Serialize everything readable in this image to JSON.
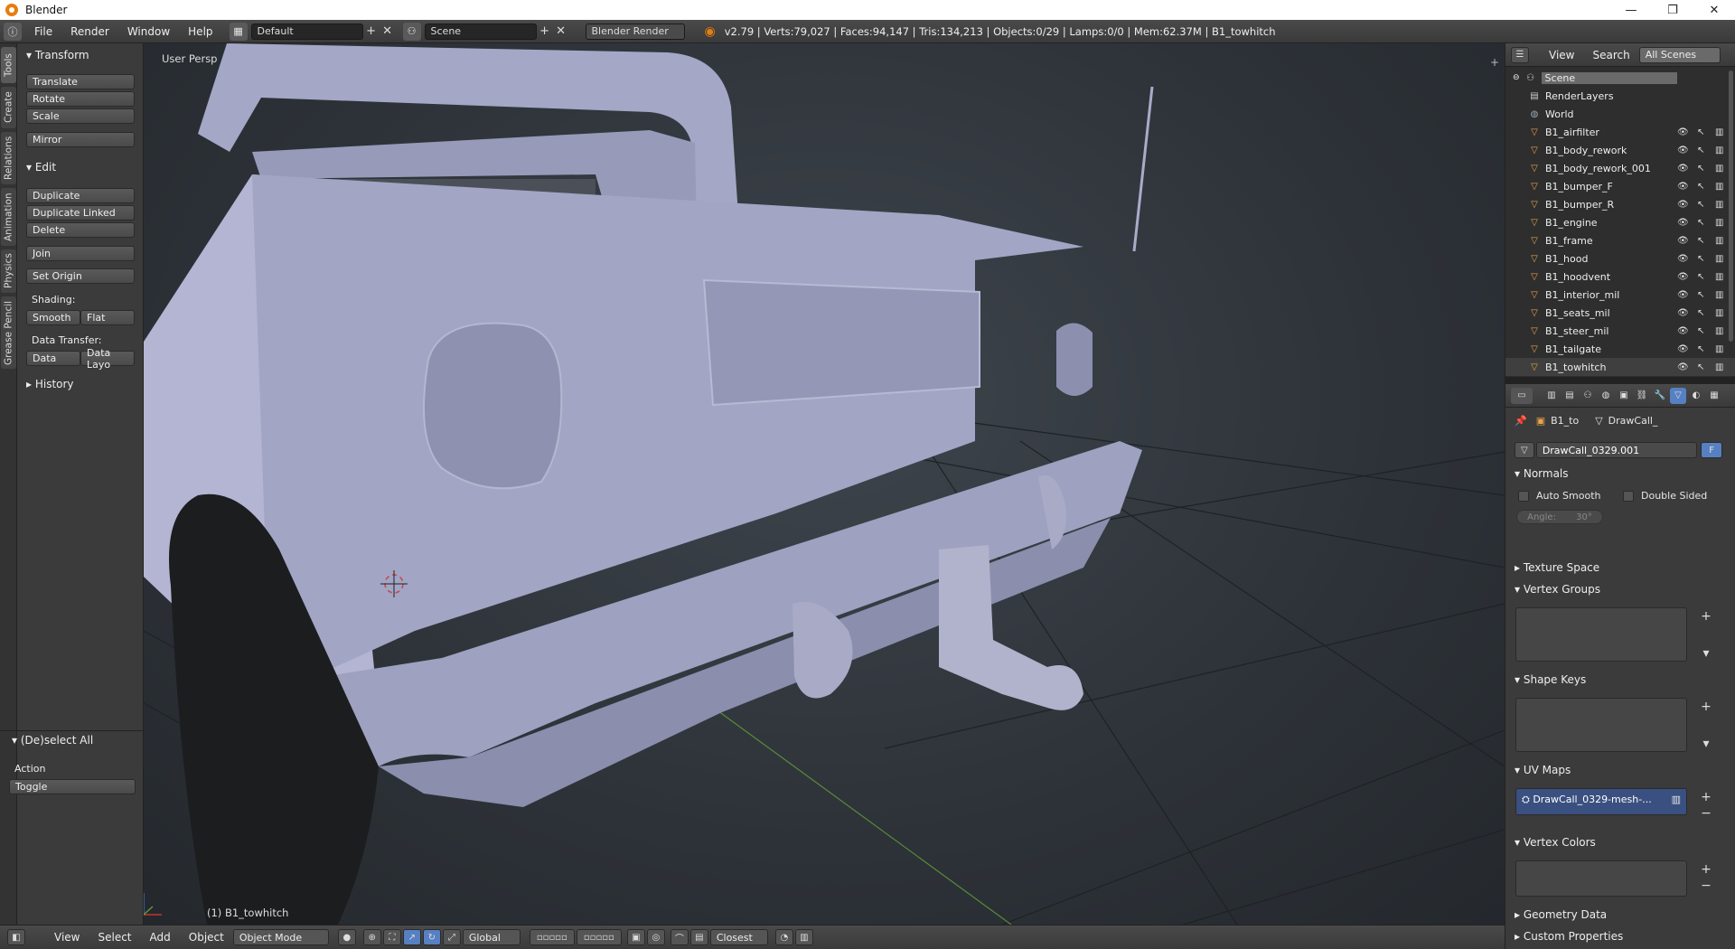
{
  "window": {
    "title": "Blender",
    "minimize": "—",
    "maximize": "❐",
    "close": "✕"
  },
  "infobar": {
    "menus": [
      "File",
      "Render",
      "Window",
      "Help"
    ],
    "layout": "Default",
    "scene": "Scene",
    "engine": "Blender Render",
    "stats": "v2.79 | Verts:79,027 | Faces:94,147 | Tris:134,213 | Objects:0/29 | Lamps:0/0 | Mem:62.37M | B1_towhitch"
  },
  "tool_tabs": [
    "Tools",
    "Create",
    "Relations",
    "Animation",
    "Physics",
    "Grease Pencil"
  ],
  "tool_shelf": {
    "transform_header": "Transform",
    "translate": "Translate",
    "rotate": "Rotate",
    "scale": "Scale",
    "mirror": "Mirror",
    "edit_header": "Edit",
    "duplicate": "Duplicate",
    "duplicate_linked": "Duplicate Linked",
    "delete": "Delete",
    "join": "Join",
    "set_origin": "Set Origin",
    "shading_label": "Shading:",
    "smooth": "Smooth",
    "flat": "Flat",
    "data_transfer_label": "Data Transfer:",
    "data": "Data",
    "data_layout": "Data Layo",
    "history_header": "History"
  },
  "operator_panel": {
    "header": "(De)select All",
    "action_label": "Action",
    "action_value": "Toggle"
  },
  "viewport": {
    "view_name": "User Persp",
    "object_label": "(1) B1_towhitch"
  },
  "bottombar": {
    "menus": [
      "View",
      "Select",
      "Add",
      "Object"
    ],
    "mode": "Object Mode",
    "orientation": "Global",
    "snap": "Closest"
  },
  "outliner": {
    "menus": [
      "View",
      "Search"
    ],
    "filter": "All Scenes",
    "scene": "Scene",
    "render_layers": "RenderLayers",
    "world": "World",
    "objects": [
      "B1_airfilter",
      "B1_body_rework",
      "B1_body_rework_001",
      "B1_bumper_F",
      "B1_bumper_R",
      "B1_engine",
      "B1_frame",
      "B1_hood",
      "B1_hoodvent",
      "B1_interior_mil",
      "B1_seats_mil",
      "B1_steer_mil",
      "B1_tailgate",
      "B1_towhitch"
    ]
  },
  "properties": {
    "context_object": "B1_to",
    "context_data": "DrawCall_",
    "mesh_name": "DrawCall_0329.001",
    "fake_user": "F",
    "normals_header": "Normals",
    "auto_smooth": "Auto Smooth",
    "double_sided": "Double Sided",
    "angle": "Angle:",
    "angle_value": "30°",
    "texture_space": "Texture Space",
    "vertex_groups": "Vertex Groups",
    "shape_keys": "Shape Keys",
    "uv_maps": "UV Maps",
    "uv_map_name": "DrawCall_0329-mesh-...",
    "vertex_colors": "Vertex Colors",
    "geometry_data": "Geometry Data",
    "custom_properties": "Custom Properties"
  }
}
